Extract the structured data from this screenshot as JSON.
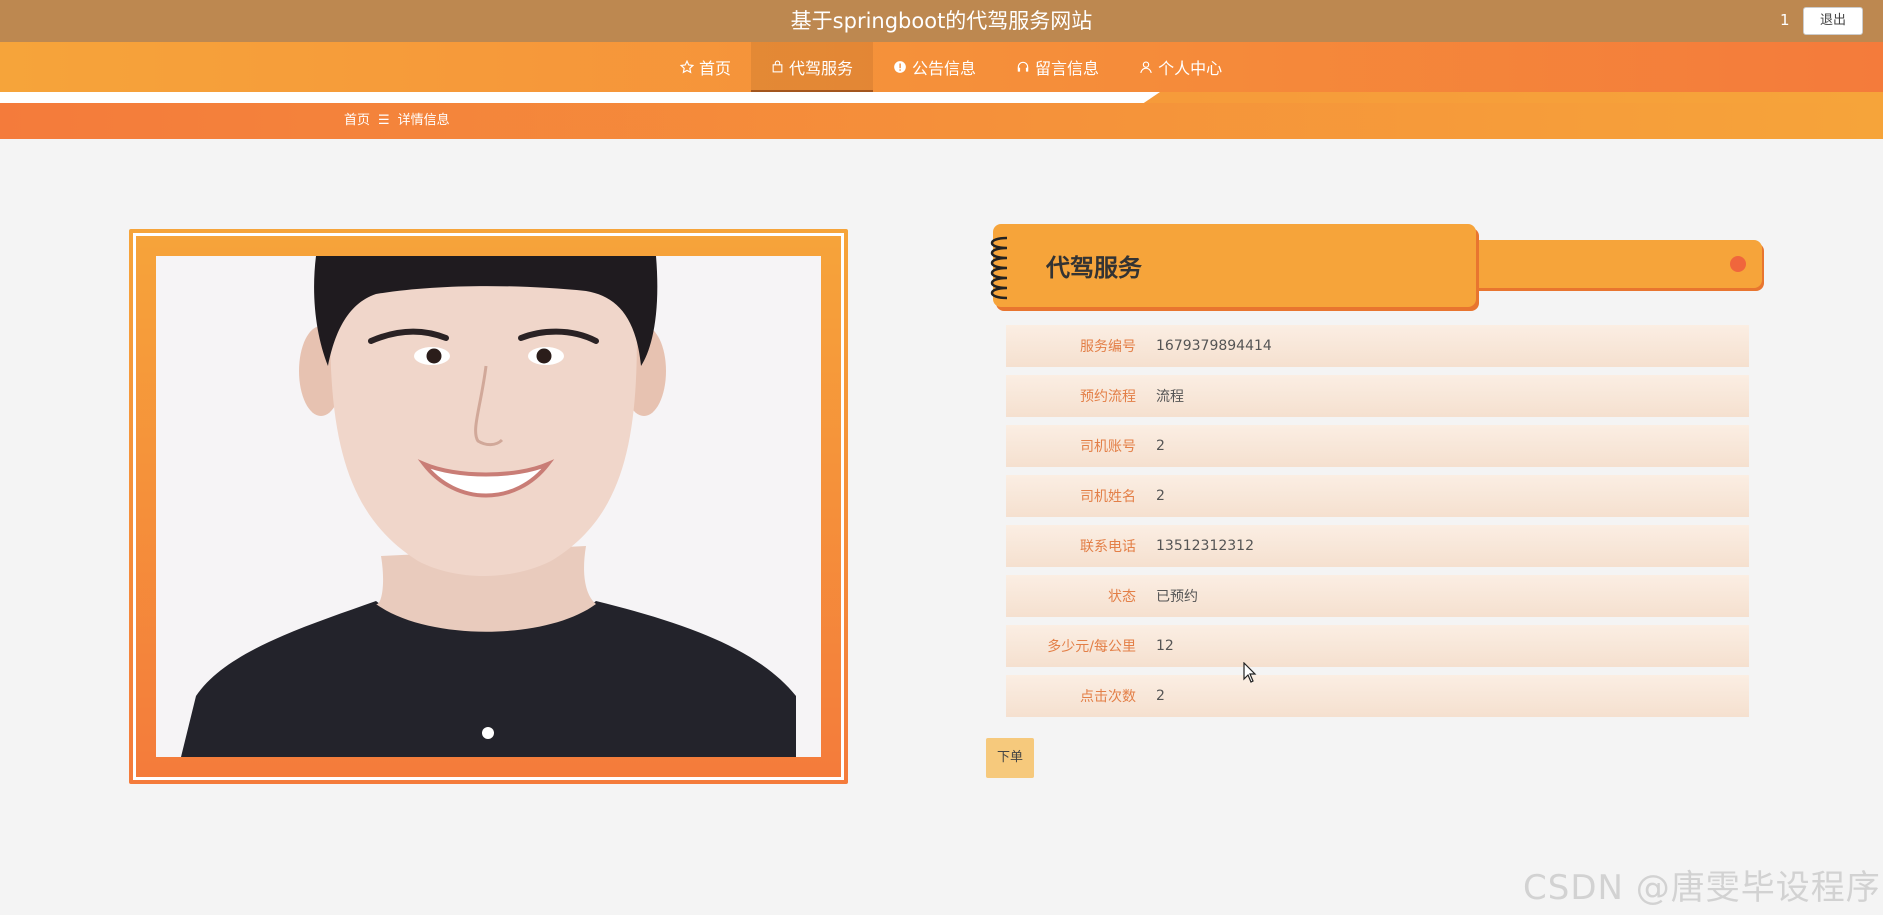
{
  "header": {
    "site_title": "基于springboot的代驾服务网站",
    "user": "1",
    "logout_label": "退出"
  },
  "nav": {
    "items": [
      {
        "label": "首页",
        "icon": "star-icon"
      },
      {
        "label": "代驾服务",
        "icon": "bag-icon"
      },
      {
        "label": "公告信息",
        "icon": "info-circle-icon"
      },
      {
        "label": "留言信息",
        "icon": "headset-icon"
      },
      {
        "label": "个人中心",
        "icon": "user-icon"
      }
    ],
    "active_index": 1
  },
  "breadcrumb": {
    "home": "首页",
    "separator": "☰",
    "current": "详情信息"
  },
  "detail": {
    "title": "代驾服务",
    "fields": [
      {
        "label": "服务编号",
        "value": "1679379894414"
      },
      {
        "label": "预约流程",
        "value": "流程"
      },
      {
        "label": "司机账号",
        "value": "2"
      },
      {
        "label": "司机姓名",
        "value": "2"
      },
      {
        "label": "联系电话",
        "value": "13512312312"
      },
      {
        "label": "状态",
        "value": "已预约"
      },
      {
        "label": "多少元/每公里",
        "value": "12"
      },
      {
        "label": "点击次数",
        "value": "2"
      }
    ],
    "order_label": "下单"
  },
  "watermark": "CSDN @唐雯毕设程序",
  "colors": {
    "topbar": "#bd8850",
    "accent_orange": "#f6a43a",
    "accent_deep": "#f47b3b",
    "label_color": "#e37f47",
    "order_button": "#f6c97c"
  }
}
